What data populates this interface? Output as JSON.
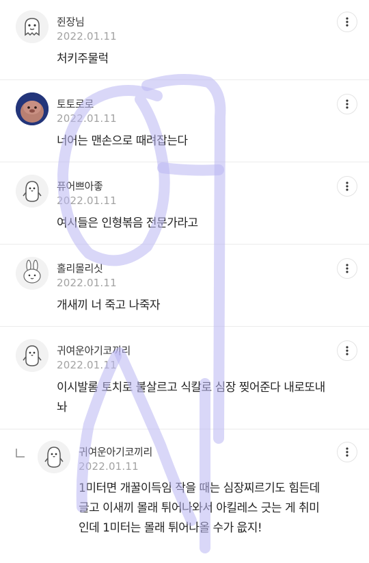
{
  "comments": [
    {
      "author": "쥔장님",
      "date": "2022.01.11",
      "text": "처키주물럭",
      "avatar_icon": "ghost-avatar-icon"
    },
    {
      "author": "토토로로",
      "date": "2022.01.11",
      "text": "너어는 맨손으로 때려잡는다",
      "avatar_icon": "pink-character-avatar-icon"
    },
    {
      "author": "퓨어쁘아좋",
      "date": "2022.01.11",
      "text": "여시들은 인형볶음 전문가라고",
      "avatar_icon": "penguin-avatar-icon"
    },
    {
      "author": "홀리몰리싯",
      "date": "2022.01.11",
      "text": "개새끼 너 죽고 나죽자",
      "avatar_icon": "rabbit-avatar-icon"
    },
    {
      "author": "귀여운아기코끼리",
      "date": "2022.01.11",
      "text": "이시발롬 토치로 불살르고 식칼로 심장 찢어준다 내로또내놔",
      "avatar_icon": "penguin-avatar-icon"
    }
  ],
  "reply": {
    "author": "귀여운아기코끼리",
    "date": "2022.01.11",
    "text": "1미터면 개꿀이득임 작을 때는 심장찌르기도 힘든데 글고 이새끼 몰래 튀어나와서 아킬레스 긋는 게 취미인데 1미터는 몰래 튀어나올 수가 읎지!",
    "avatar_icon": "penguin-avatar-icon"
  },
  "colors": {
    "watermark": "#b9b6f2",
    "date": "#a2a2a2",
    "divider": "#ebebeb"
  }
}
